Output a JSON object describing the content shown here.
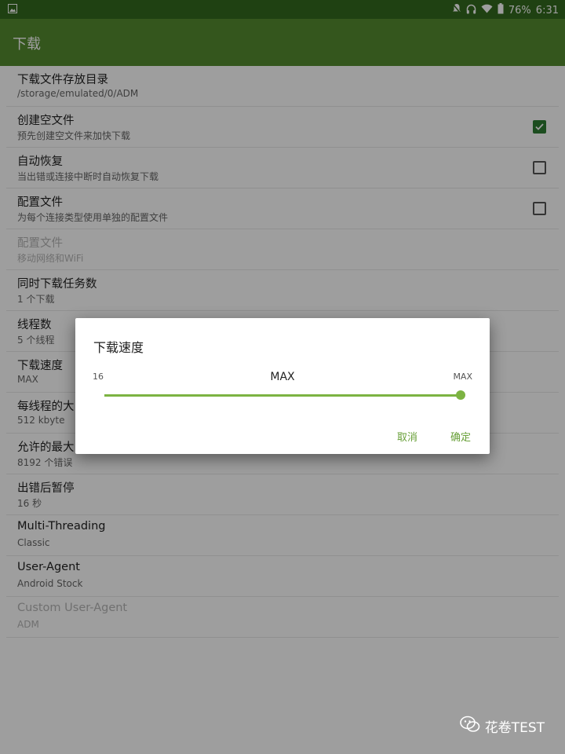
{
  "status_bar": {
    "battery": "76%",
    "time": "6:31",
    "icons": [
      "image-icon",
      "bell-off-icon",
      "headphones-icon",
      "wifi-icon",
      "battery-icon"
    ]
  },
  "app_bar": {
    "title": "下载"
  },
  "settings": [
    {
      "title": "下载文件存放目录",
      "summary": "/storage/emulated/0/ADM",
      "checkbox": null,
      "disabled": false
    },
    {
      "title": "创建空文件",
      "summary": "预先创建空文件来加快下载",
      "checkbox": true,
      "disabled": false
    },
    {
      "title": "自动恢复",
      "summary": "当出错或连接中断时自动恢复下载",
      "checkbox": false,
      "disabled": false
    },
    {
      "title": "配置文件",
      "summary": "为每个连接类型使用单独的配置文件",
      "checkbox": false,
      "disabled": false
    },
    {
      "title": "配置文件",
      "summary": "移动网络和WiFi",
      "checkbox": null,
      "disabled": true
    },
    {
      "title": "同时下载任务数",
      "summary": "1 个下载",
      "checkbox": null,
      "disabled": false
    },
    {
      "title": "线程数",
      "summary": "5 个线程",
      "checkbox": null,
      "disabled": false
    },
    {
      "title": "下载速度",
      "summary": "MAX",
      "checkbox": null,
      "disabled": false
    },
    {
      "title": "每线程的大",
      "summary": "512 kbyte",
      "checkbox": null,
      "disabled": false
    },
    {
      "title": "允许的最大",
      "summary": "8192 个错误",
      "checkbox": null,
      "disabled": false
    },
    {
      "title": "出错后暂停",
      "summary": "16 秒",
      "checkbox": null,
      "disabled": false
    },
    {
      "title": "Multi-Threading",
      "summary": "Classic",
      "checkbox": null,
      "disabled": false
    },
    {
      "title": "User-Agent",
      "summary": "Android Stock",
      "checkbox": null,
      "disabled": false
    },
    {
      "title": "Custom User-Agent",
      "summary": "ADM",
      "checkbox": null,
      "disabled": true
    }
  ],
  "dialog": {
    "title": "下载速度",
    "min_label": "16",
    "max_label": "MAX",
    "current_value": "MAX",
    "slider_fraction": 1.0,
    "cancel_label": "取消",
    "ok_label": "确定",
    "accent_color": "#7cb342"
  },
  "watermark": {
    "text": "花卷TEST",
    "icon": "wechat-icon"
  },
  "colors": {
    "app_bar": "#558b2f",
    "status_bar": "#33691e",
    "checkbox_checked": "#2e7d32"
  }
}
